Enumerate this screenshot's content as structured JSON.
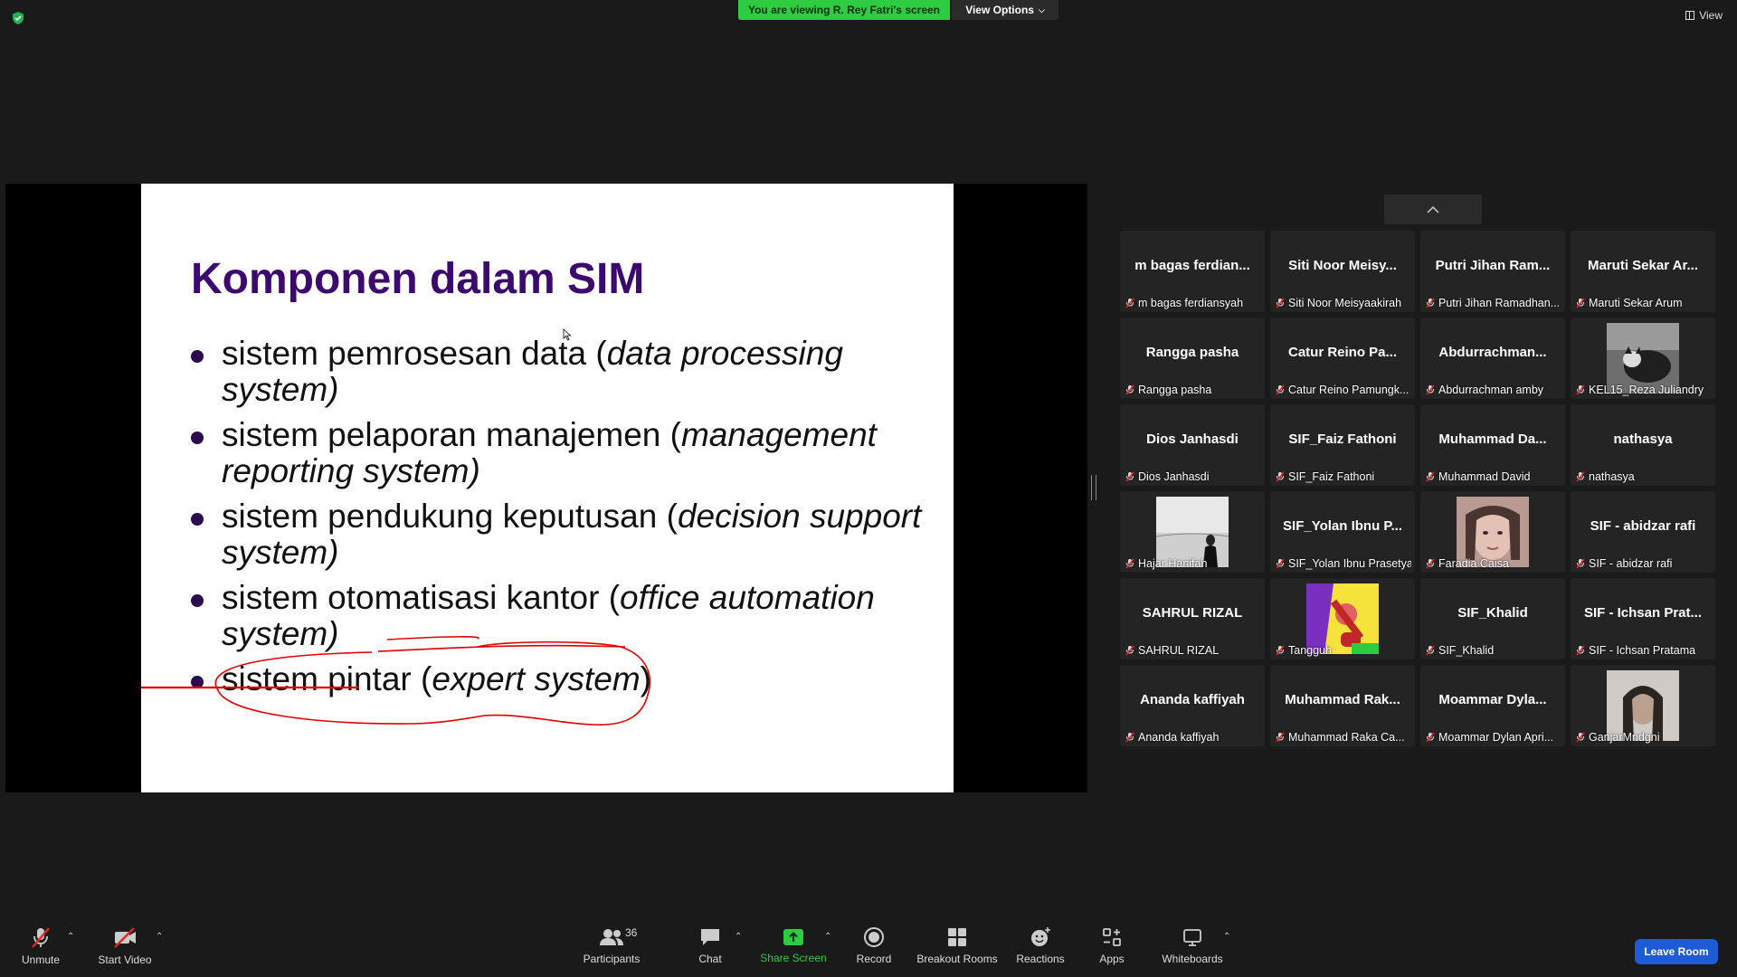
{
  "top_bar": {
    "viewing_banner": "You are viewing R. Rey Fatri's screen",
    "view_options_label": "View Options",
    "view_label": "View"
  },
  "slide": {
    "title": "Komponen dalam SIM",
    "bullets": [
      {
        "plain": "sistem pemrosesan data (",
        "italic": "data  processing system)",
        "tail": ""
      },
      {
        "plain": "sistem pelaporan manajemen (",
        "italic": "management reporting system)",
        "tail": ""
      },
      {
        "plain": "sistem pendukung keputusan (",
        "italic": "decision support  system)",
        "tail": ""
      },
      {
        "plain": "sistem otomatisasi kantor (",
        "italic": "office automation system)",
        "tail": ""
      },
      {
        "plain": "sistem pintar (",
        "italic": "expert system",
        "tail": ")"
      }
    ],
    "annotation_color": "#e00000",
    "title_color": "#3c0a6e"
  },
  "participants": [
    {
      "big": "m bagas ferdian...",
      "label": "m bagas ferdiansyah"
    },
    {
      "big": "Siti Noor Meisy...",
      "label": "Siti Noor Meisyaakirah"
    },
    {
      "big": "Putri Jihan Ram...",
      "label": "Putri Jihan Ramadhan..."
    },
    {
      "big": "Maruti Sekar Ar...",
      "label": "Maruti Sekar Arum"
    },
    {
      "big": "Rangga pasha",
      "label": "Rangga pasha"
    },
    {
      "big": "Catur Reino Pa...",
      "label": "Catur Reino Pamungk..."
    },
    {
      "big": "Abdurrachman...",
      "label": "Abdurrachman amby"
    },
    {
      "big": "",
      "label": "KEL15_Reza Juliandry",
      "video": "cat"
    },
    {
      "big": "Dios Janhasdi",
      "label": "Dios Janhasdi"
    },
    {
      "big": "SIF_Faiz Fathoni",
      "label": "SIF_Faiz Fathoni"
    },
    {
      "big": "Muhammad  Da...",
      "label": "Muhammad David"
    },
    {
      "big": "nathasya",
      "label": "nathasya"
    },
    {
      "big": "",
      "label": "Hajar Hanifah",
      "video": "bw"
    },
    {
      "big": "SIF_Yolan Ibnu P...",
      "label": "SIF_Yolan Ibnu Prasetya"
    },
    {
      "big": "",
      "label": "Faradia Caisa",
      "video": "face"
    },
    {
      "big": "SIF - abidzar rafi",
      "label": "SIF - abidzar rafi"
    },
    {
      "big": "SAHRUL RIZAL",
      "label": "SAHRUL RIZAL"
    },
    {
      "big": "",
      "label": "Tangguh",
      "video": "art"
    },
    {
      "big": "SIF_Khalid",
      "label": "SIF_Khalid"
    },
    {
      "big": "SIF - Ichsan Prat...",
      "label": "SIF - Ichsan Pratama"
    },
    {
      "big": "Ananda kaffiyah",
      "label": "Ananda kaffiyah"
    },
    {
      "big": "Muhammad  Rak...",
      "label": "Muhammad Raka Ca..."
    },
    {
      "big": "Moammar  Dyla...",
      "label": "Moammar Dylan Apri..."
    },
    {
      "big": "",
      "label": "GanjarMndgni",
      "video": "dark"
    }
  ],
  "toolbar": {
    "unmute": "Unmute",
    "start_video": "Start Video",
    "participants": "Participants",
    "participants_count": "36",
    "chat": "Chat",
    "share_screen": "Share Screen",
    "record": "Record",
    "breakout_rooms": "Breakout Rooms",
    "reactions": "Reactions",
    "apps": "Apps",
    "whiteboards": "Whiteboards",
    "leave_room": "Leave Room",
    "share_color": "#2ecc40",
    "leave_color": "#1e5bd6"
  }
}
